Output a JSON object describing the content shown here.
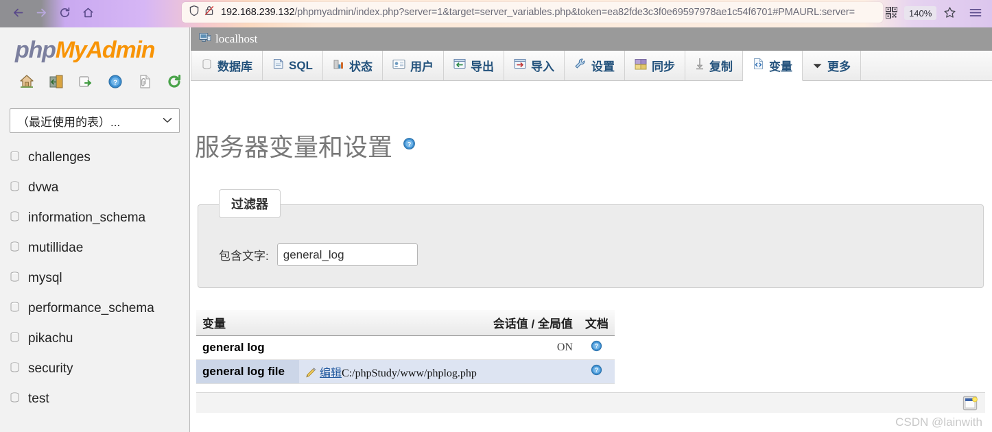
{
  "browser": {
    "back_icon": "back-arrow-icon",
    "forward_icon": "forward-arrow-icon",
    "reload_icon": "reload-icon",
    "home_icon": "home-icon",
    "shield_icon": "shield-icon",
    "lock_icon": "lock-crossed-icon",
    "url_host": "192.168.239.132",
    "url_path": "/phpmyadmin/index.php?server=1&target=server_variables.php&token=ea82fde3c3f0e69597978ae1c54f6701#PMAURL:server=",
    "qr_icon": "qr-code-icon",
    "zoom_level": "140%",
    "star_icon": "bookmark-star-icon",
    "menu_icon": "hamburger-menu-icon"
  },
  "sidebar": {
    "logo_php": "php",
    "logo_myadmin": "MyAdmin",
    "icons": [
      {
        "name": "home-icon"
      },
      {
        "name": "logout-icon"
      },
      {
        "name": "query-window-icon"
      },
      {
        "name": "help-icon"
      },
      {
        "name": "documentation-icon"
      },
      {
        "name": "refresh-icon"
      }
    ],
    "db_select_value": "（最近使用的表）...",
    "db_select_chevron": "⌄",
    "databases": [
      {
        "label": "challenges"
      },
      {
        "label": "dvwa"
      },
      {
        "label": "information_schema"
      },
      {
        "label": "mutillidae"
      },
      {
        "label": "mysql"
      },
      {
        "label": "performance_schema"
      },
      {
        "label": "pikachu"
      },
      {
        "label": "security"
      },
      {
        "label": "test"
      }
    ]
  },
  "main": {
    "server_label": "localhost",
    "server_icon": "server-icon",
    "tabs": [
      {
        "label": "数据库",
        "icon": "database-icon",
        "active": false
      },
      {
        "label": "SQL",
        "icon": "sql-page-icon",
        "active": false
      },
      {
        "label": "状态",
        "icon": "status-chart-icon",
        "active": false
      },
      {
        "label": "用户",
        "icon": "users-icon",
        "active": false
      },
      {
        "label": "导出",
        "icon": "export-icon",
        "active": false
      },
      {
        "label": "导入",
        "icon": "import-icon",
        "active": false
      },
      {
        "label": "设置",
        "icon": "settings-wrench-icon",
        "active": false
      },
      {
        "label": "同步",
        "icon": "sync-icon",
        "active": false
      },
      {
        "label": "复制",
        "icon": "replication-icon",
        "active": false
      },
      {
        "label": "变量",
        "icon": "variables-icon",
        "active": true
      },
      {
        "label": "更多",
        "icon": "chevron-down-icon",
        "active": false
      }
    ],
    "page_title": "服务器变量和设置",
    "page_title_help_icon": "help-icon",
    "filter": {
      "legend": "过滤器",
      "label": "包含文字:",
      "value": "general_log",
      "placeholder": ""
    },
    "table": {
      "headers": [
        "变量",
        "",
        "会话值 / 全局值",
        "文档"
      ],
      "rows": [
        {
          "name": "general log",
          "edit_icon": "",
          "edit_label": "",
          "edit_path": "",
          "value": "ON",
          "doc_icon": "help-icon",
          "highlight": false
        },
        {
          "name": "general log file",
          "edit_icon": "pencil-edit-icon",
          "edit_label": "编辑",
          "edit_path": "C:/phpStudy/www/phplog.php",
          "value": "",
          "doc_icon": "help-icon",
          "highlight": true
        }
      ]
    },
    "console_toggle_icon": "console-window-icon"
  },
  "watermark": "CSDN @lainwith",
  "colors": {
    "accent_blue": "#23527c",
    "logo_orange": "#f89406",
    "logo_purple": "#7b7f9e",
    "row_highlight": "#dde4f2",
    "breadcrumb_bg": "#9a9a9a"
  }
}
